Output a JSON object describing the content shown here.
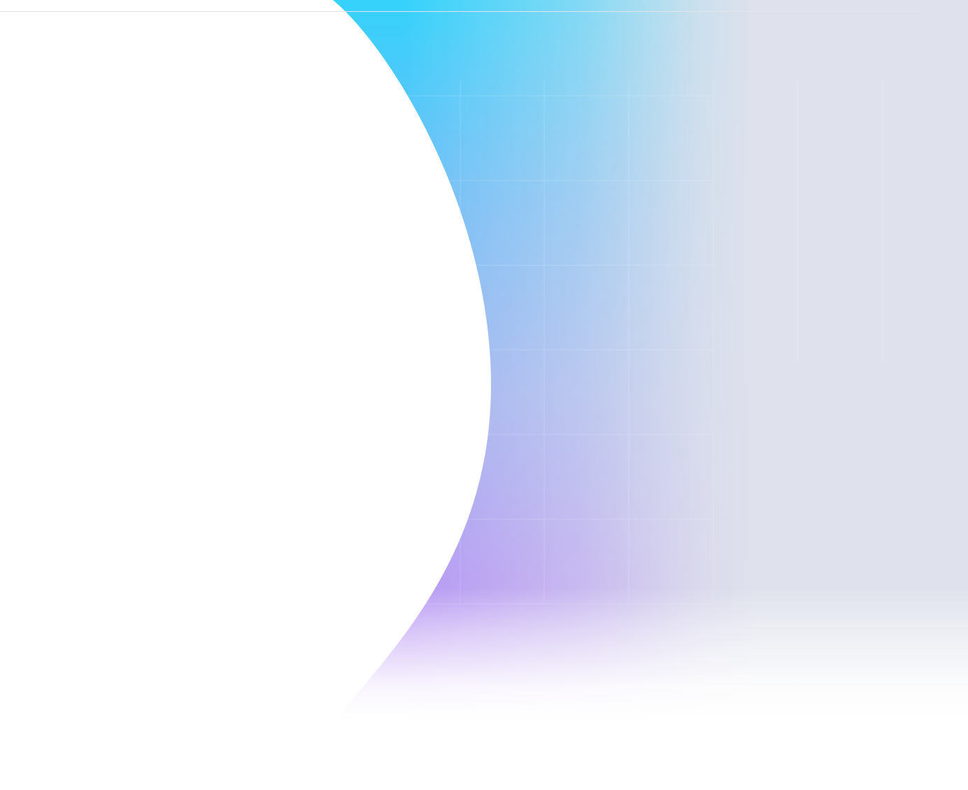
{
  "hero": {
    "colors": {
      "page_background": "#ffffff",
      "panel_gray": "#dfe2ec",
      "gradient_cyan": "#35d2fb",
      "gradient_sky": "#7bd8f3",
      "gradient_blue": "#98b4f0",
      "gradient_violet": "#b29af3",
      "grid_line": "#ffffff",
      "divider": "#e3e5ec"
    },
    "decorations": {
      "backdrop": "gradient-backdrop",
      "shape": "white-crescent-shape",
      "grid": "grid-lines"
    }
  }
}
